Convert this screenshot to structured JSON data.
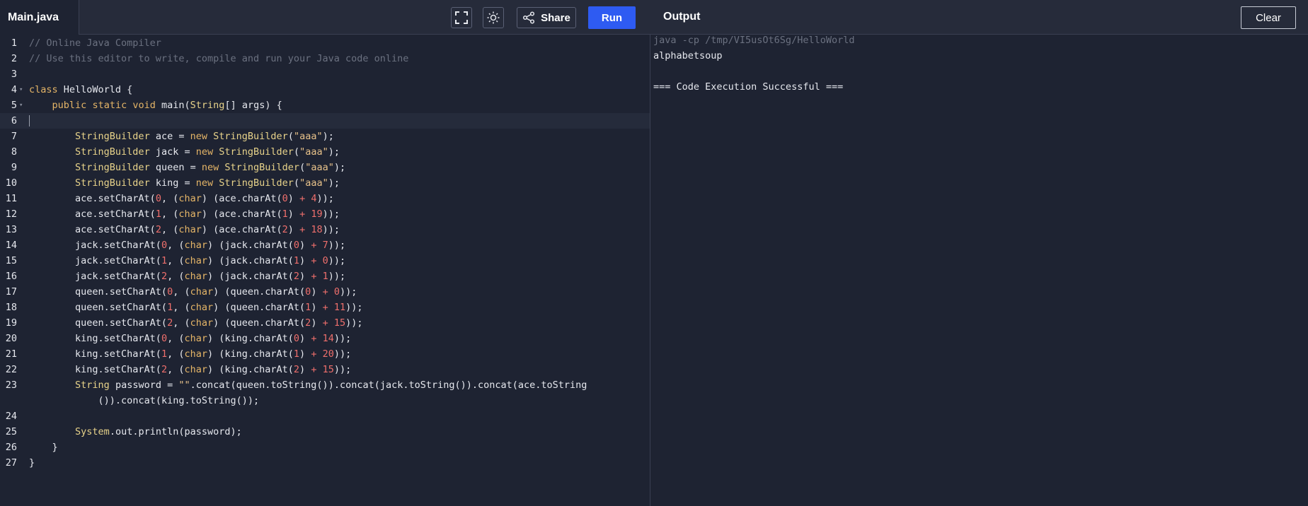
{
  "file_tab": {
    "label": "Main.java"
  },
  "toolbar": {
    "share_label": "Share",
    "run_label": "Run"
  },
  "output_panel": {
    "title": "Output",
    "clear_label": "Clear",
    "command": "java -cp /tmp/VI5usOt6Sg/HelloWorld",
    "result": "alphabetsoup",
    "status": "=== Code Execution Successful ==="
  },
  "editor": {
    "lines": [
      {
        "n": "1",
        "text": "// Online Java Compiler"
      },
      {
        "n": "2",
        "text": "// Use this editor to write, compile and run your Java code online"
      },
      {
        "n": "3",
        "text": ""
      },
      {
        "n": "4",
        "text": "class HelloWorld {"
      },
      {
        "n": "5",
        "text": "    public static void main(String[] args) {"
      },
      {
        "n": "6",
        "text": ""
      },
      {
        "n": "7",
        "text": "        StringBuilder ace = new StringBuilder(\"aaa\");"
      },
      {
        "n": "8",
        "text": "        StringBuilder jack = new StringBuilder(\"aaa\");"
      },
      {
        "n": "9",
        "text": "        StringBuilder queen = new StringBuilder(\"aaa\");"
      },
      {
        "n": "10",
        "text": "        StringBuilder king = new StringBuilder(\"aaa\");"
      },
      {
        "n": "11",
        "text": "        ace.setCharAt(0, (char) (ace.charAt(0) + 4));"
      },
      {
        "n": "12",
        "text": "        ace.setCharAt(1, (char) (ace.charAt(1) + 19));"
      },
      {
        "n": "13",
        "text": "        ace.setCharAt(2, (char) (ace.charAt(2) + 18));"
      },
      {
        "n": "14",
        "text": "        jack.setCharAt(0, (char) (jack.charAt(0) + 7));"
      },
      {
        "n": "15",
        "text": "        jack.setCharAt(1, (char) (jack.charAt(1) + 0));"
      },
      {
        "n": "16",
        "text": "        jack.setCharAt(2, (char) (jack.charAt(2) + 1));"
      },
      {
        "n": "17",
        "text": "        queen.setCharAt(0, (char) (queen.charAt(0) + 0));"
      },
      {
        "n": "18",
        "text": "        queen.setCharAt(1, (char) (queen.charAt(1) + 11));"
      },
      {
        "n": "19",
        "text": "        queen.setCharAt(2, (char) (queen.charAt(2) + 15));"
      },
      {
        "n": "20",
        "text": "        king.setCharAt(0, (char) (king.charAt(0) + 14));"
      },
      {
        "n": "21",
        "text": "        king.setCharAt(1, (char) (king.charAt(1) + 20));"
      },
      {
        "n": "22",
        "text": "        king.setCharAt(2, (char) (king.charAt(2) + 15));"
      },
      {
        "n": "23",
        "text": "        String password = \"\".concat(queen.toString()).concat(jack.toString()).concat(ace.toString\n            ()).concat(king.toString());"
      },
      {
        "n": "24",
        "text": ""
      },
      {
        "n": "25",
        "text": "        System.out.println(password);"
      },
      {
        "n": "26",
        "text": "    }"
      },
      {
        "n": "27",
        "text": "}"
      }
    ]
  }
}
